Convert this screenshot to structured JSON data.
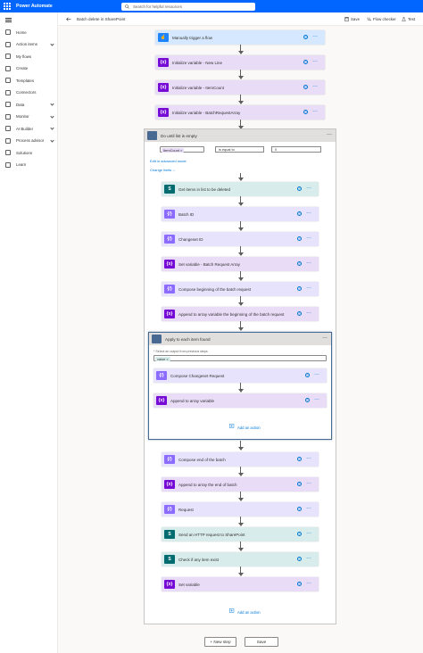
{
  "app": {
    "title": "Power Automate"
  },
  "search": {
    "placeholder": "Search for helpful resources"
  },
  "nav": {
    "items": [
      {
        "label": "Home",
        "icon": "home-icon",
        "chevron": false
      },
      {
        "label": "Action items",
        "icon": "checklist-icon",
        "chevron": true
      },
      {
        "label": "My flows",
        "icon": "flow-icon",
        "chevron": false
      },
      {
        "label": "Create",
        "icon": "plus-icon",
        "chevron": false
      },
      {
        "label": "Templates",
        "icon": "template-icon",
        "chevron": false
      },
      {
        "label": "Connectors",
        "icon": "connector-icon",
        "chevron": false
      },
      {
        "label": "Data",
        "icon": "database-icon",
        "chevron": true
      },
      {
        "label": "Monitor",
        "icon": "monitor-icon",
        "chevron": true
      },
      {
        "label": "AI Builder",
        "icon": "ai-builder-icon",
        "chevron": true
      },
      {
        "label": "Process advisor",
        "icon": "process-advisor-icon",
        "chevron": true
      },
      {
        "label": "Solutions",
        "icon": "solutions-icon",
        "chevron": false
      },
      {
        "label": "Learn",
        "icon": "book-icon",
        "chevron": false
      }
    ]
  },
  "cmdbar": {
    "flow_name": "Batch delete in SharePoint",
    "save": "Save",
    "flow_checker": "Flow checker",
    "test": "Test"
  },
  "colors": {
    "trigger": "#1f85ff",
    "variable": "#770bd6",
    "variable_bg": "#e8dcf7",
    "compose": "#8c6cff",
    "compose_bg": "#e7e3fc",
    "sharepoint": "#036c70",
    "sharepoint_bg": "#d8eceb",
    "trigger_bg": "#d6e8ff",
    "scope": "#486991"
  },
  "steps_top": [
    {
      "label": "Manually trigger a flow",
      "kind": "trigger"
    },
    {
      "label": "Initialize variable - New Line",
      "kind": "variable"
    },
    {
      "label": "Initialize variable - ItemCount",
      "kind": "variable"
    },
    {
      "label": "Initialize variable - BatchRequestArray",
      "kind": "variable"
    }
  ],
  "do_until": {
    "label": "Do until list is empty",
    "token": "ItemCount",
    "operator": "is equal to",
    "value": "0",
    "advanced_link": "Edit in advanced mode",
    "change_limits": "Change limits"
  },
  "steps_inner": [
    {
      "label": "Get items in list to be deleted",
      "kind": "sharepoint"
    },
    {
      "label": "Batch ID",
      "kind": "compose"
    },
    {
      "label": "Changeset ID",
      "kind": "compose"
    },
    {
      "label": "Set variable - Batch Request Array",
      "kind": "variable"
    },
    {
      "label": "Compose beginning of the batch request",
      "kind": "compose"
    },
    {
      "label": "Append to array variable the beginning of the batch request",
      "kind": "variable"
    }
  ],
  "apply_each": {
    "label": "Apply to each item found",
    "select_label": "* Select an output from previous steps",
    "token": "value",
    "steps": [
      {
        "label": "Compose Changeset Request",
        "kind": "compose"
      },
      {
        "label": "Append to array variable",
        "kind": "variable"
      }
    ],
    "add_action": "Add an action"
  },
  "steps_after": [
    {
      "label": "Compose end of the batch",
      "kind": "compose"
    },
    {
      "label": "Append to array the end of batch",
      "kind": "variable"
    },
    {
      "label": "Request",
      "kind": "compose"
    },
    {
      "label": "Send an HTTP request to SharePoint",
      "kind": "sharepoint"
    },
    {
      "label": "Check if any item exist",
      "kind": "sharepoint"
    },
    {
      "label": "Set variable",
      "kind": "variable"
    }
  ],
  "do_until_add_action": "Add an action",
  "footer": {
    "new_step": "+ New step",
    "save": "Save"
  }
}
